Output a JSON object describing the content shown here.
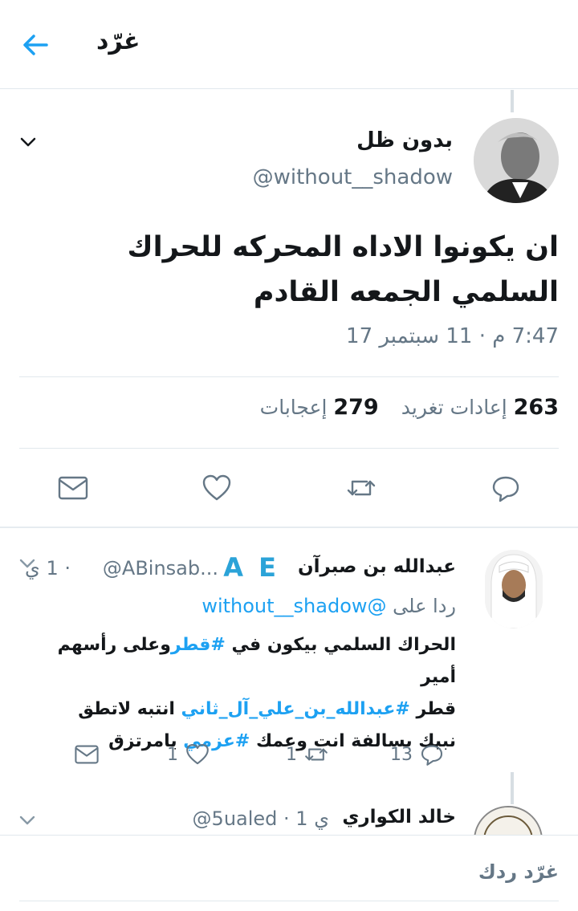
{
  "header": {
    "title": "غرّد",
    "back_icon": "back-arrow-icon",
    "accent": "#1da1f2"
  },
  "main_tweet": {
    "author_name": "بدون ظل",
    "handle": "@without__shadow",
    "text": "ان يكونوا الاداه المحركه للحراك السلمي الجمعه القادم",
    "time": "7:47 م · 11 سبتمبر 17",
    "stats": {
      "retweets_count": "263",
      "retweets_label": "إعادات تغريد",
      "likes_count": "279",
      "likes_label": "إعجابات"
    },
    "actions": [
      "reply-icon",
      "retweet-icon",
      "like-icon",
      "message-icon"
    ]
  },
  "reply": {
    "author_name": "عبدالله بن صبرآن",
    "logo_text": "A E",
    "handle": "@ABinsab...",
    "meta": "· 1 ي",
    "reply_to_label": "ردا على",
    "reply_to_handle": "@without__shadow",
    "line1_a": "الحراك السلمي بيكون في ",
    "line1_tag": "#قطر",
    "line1_b": "وعلى رأسهم أمير",
    "line2_a": "قطر ",
    "line2_tag": "#عبدالله_بن_علي_آل_ثاني",
    "line2_b": " انتبه لاتطق",
    "line3_a": "نبيك بسالفة انت وعمك ",
    "line3_tag": "#عزمي",
    "line3_b": " يامرتزق",
    "reply_count": "13",
    "retweet_count": "1",
    "like_count": "1"
  },
  "reply2": {
    "author_name": "خالد الكواري",
    "handle": "@5ualed",
    "meta": "· 1 ي"
  },
  "compose": {
    "placeholder": "غرّد ردك"
  }
}
